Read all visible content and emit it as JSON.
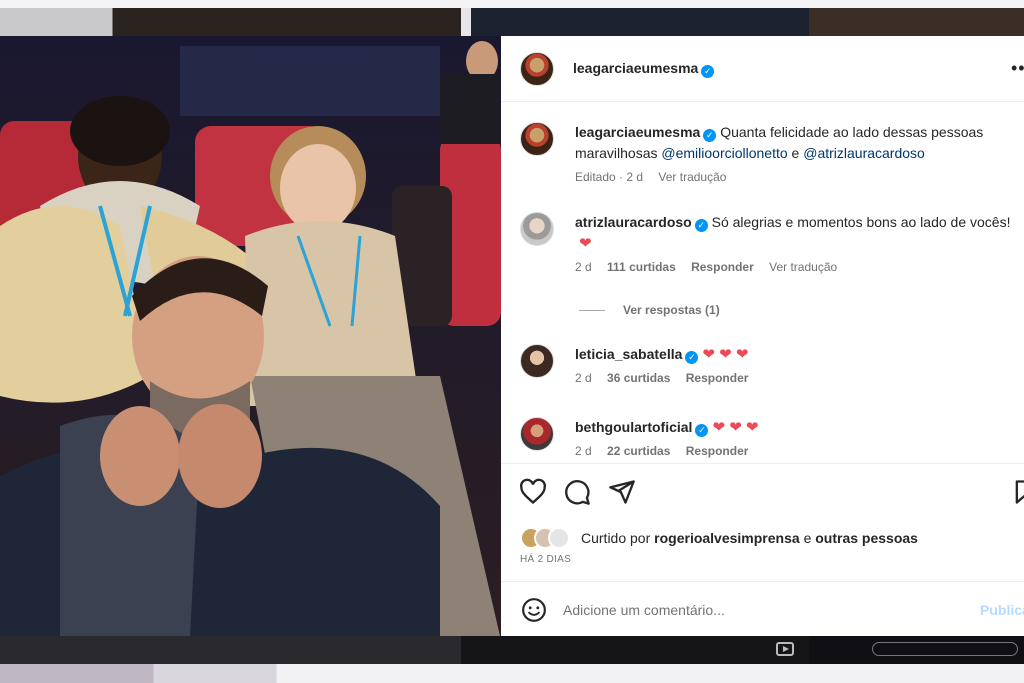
{
  "post": {
    "author": "leagarciaeumesma",
    "more_label": "•••"
  },
  "caption": {
    "author": "leagarciaeumesma",
    "text_part1": "Quanta felicidade ao lado dessas pessoas maravilhosas ",
    "mention1": "@emilioorciollonetto",
    "conj": " e ",
    "mention2": "@atrizlauracardoso",
    "edited": "Editado · 2 d",
    "translate": "Ver tradução"
  },
  "comments": [
    {
      "author": "atrizlauracardoso",
      "text": "Só alegrias e momentos bons ao lado de vocês!",
      "hearts": "❤",
      "age": "2 d",
      "likes": "111 curtidas",
      "reply": "Responder",
      "translate": "Ver tradução",
      "view_replies": "Ver respostas (1)"
    },
    {
      "author": "leticia_sabatella",
      "hearts": "❤ ❤ ❤",
      "age": "2 d",
      "likes": "36 curtidas",
      "reply": "Responder"
    },
    {
      "author": "bethgoulartoficial",
      "hearts": "❤ ❤ ❤",
      "age": "2 d",
      "likes": "22 curtidas",
      "reply": "Responder"
    }
  ],
  "likes": {
    "prefix": "Curtido por",
    "user": "rogerioalvesimprensa",
    "conj": "e",
    "others": "outras pessoas"
  },
  "date": "HÁ 2 DIAS",
  "add_comment": {
    "placeholder": "Adicione um comentário...",
    "publish": "Publicar"
  },
  "icons": [
    "heart-icon",
    "comment-icon",
    "share-icon",
    "bookmark-icon",
    "emoji-icon",
    "more-icon",
    "verified-icon"
  ],
  "colors": {
    "verified": "#0095f6",
    "heart": "#ed4956",
    "mention": "#00376b",
    "publish_disabled": "#b3dbff"
  }
}
